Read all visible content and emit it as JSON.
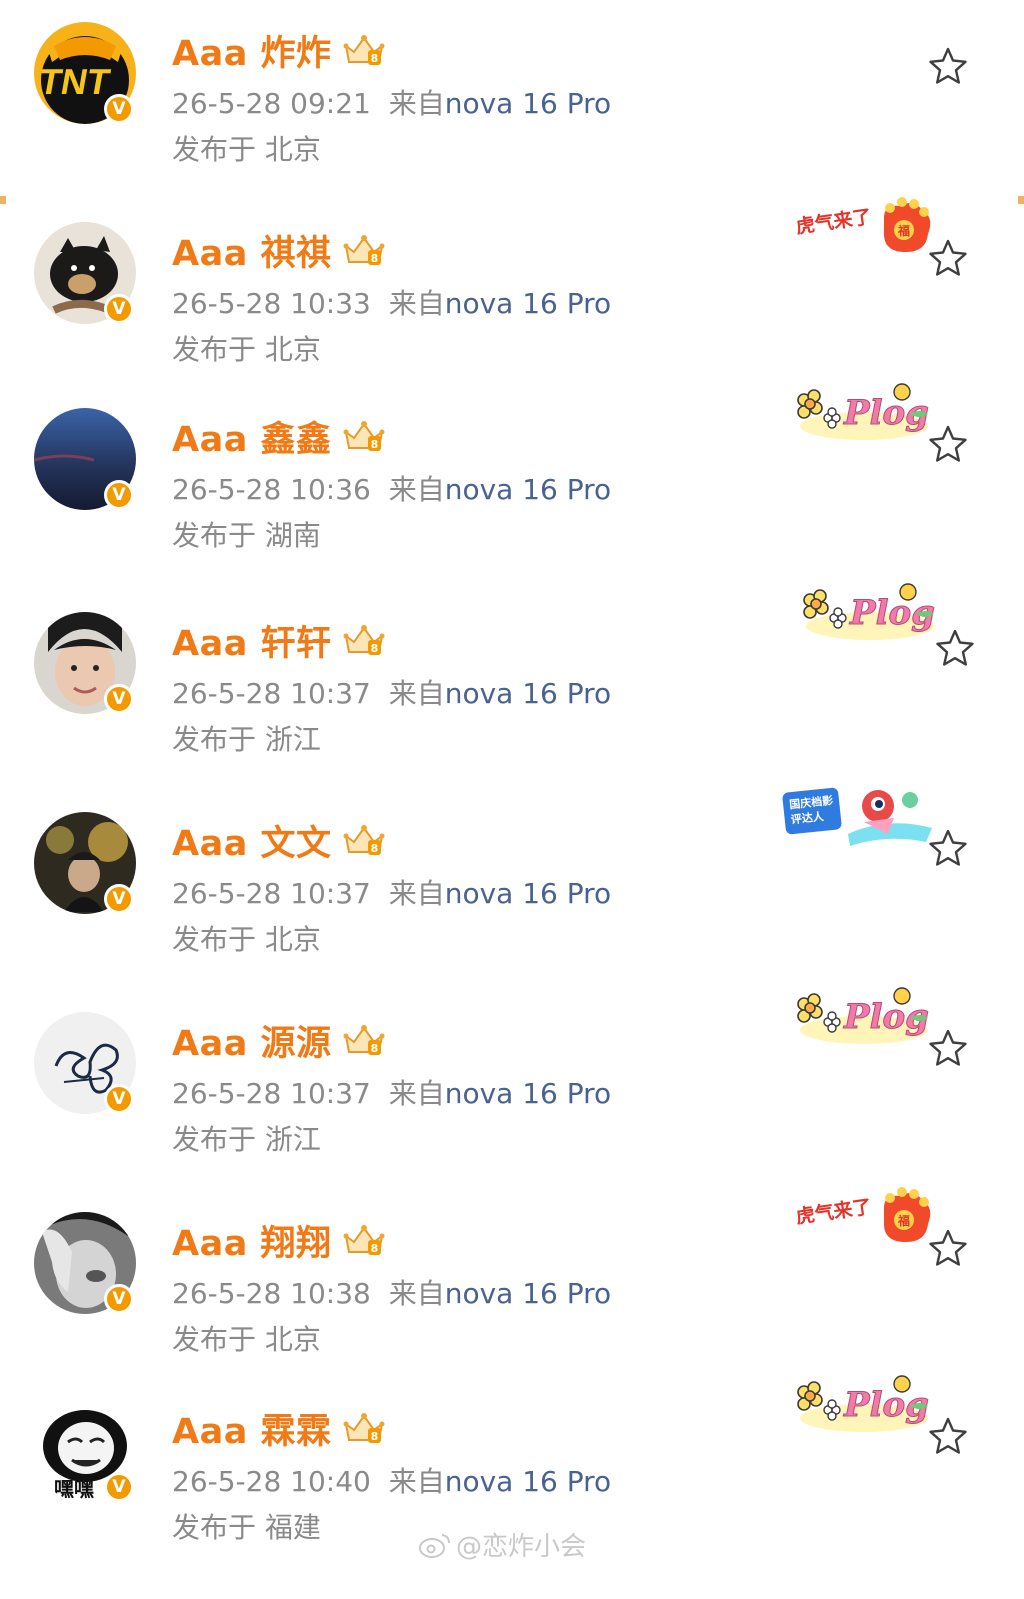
{
  "posts": [
    {
      "name": "Aaa 炸炸",
      "time": "26-5-28 09:21",
      "from": "来自",
      "device": "nova 16 Pro",
      "location": "发布于 北京",
      "avatar_icon": "tnt-tiger-avatar-icon",
      "sticker": "none"
    },
    {
      "name": "Aaa 祺祺",
      "time": "26-5-28 10:33",
      "from": "来自",
      "device": "nova 16 Pro",
      "location": "发布于 北京",
      "avatar_icon": "shiba-dog-avatar-icon",
      "sticker": "tiger-paw",
      "sticker_text": "虎气来了"
    },
    {
      "name": "Aaa 鑫鑫",
      "time": "26-5-28 10:36",
      "from": "来自",
      "device": "nova 16 Pro",
      "location": "发布于 湖南",
      "avatar_icon": "night-sky-avatar-icon",
      "sticker": "plog",
      "sticker_text": "Plog"
    },
    {
      "name": "Aaa 轩轩",
      "time": "26-5-28 10:37",
      "from": "来自",
      "device": "nova 16 Pro",
      "location": "发布于 浙江",
      "avatar_icon": "face-photo-avatar-icon",
      "sticker": "plog",
      "sticker_text": "Plog"
    },
    {
      "name": "Aaa 文文",
      "time": "26-5-28 10:37",
      "from": "来自",
      "device": "nova 16 Pro",
      "location": "发布于 北京",
      "avatar_icon": "stage-photo-avatar-icon",
      "sticker": "critic",
      "sticker_text": "国庆档影评达人"
    },
    {
      "name": "Aaa 源源",
      "time": "26-5-28 10:37",
      "from": "来自",
      "device": "nova 16 Pro",
      "location": "发布于 浙江",
      "avatar_icon": "butterfly-signature-avatar-icon",
      "sticker": "plog",
      "sticker_text": "Plog"
    },
    {
      "name": "Aaa 翔翔",
      "time": "26-5-28 10:38",
      "from": "来自",
      "device": "nova 16 Pro",
      "location": "发布于 北京",
      "avatar_icon": "bw-hand-photo-avatar-icon",
      "sticker": "tiger-paw",
      "sticker_text": "虎气来了"
    },
    {
      "name": "Aaa 霖霖",
      "time": "26-5-28 10:40",
      "from": "来自",
      "device": "nova 16 Pro",
      "location": "发布于 福建",
      "avatar_icon": "panda-meme-avatar-icon",
      "avatar_text": "嘿嘿",
      "sticker": "plog",
      "sticker_text": "Plog"
    }
  ],
  "verified_badge": "V",
  "watermark": "@恋炸小会",
  "colors": {
    "name": "#f07b16",
    "meta": "#8a8a8a",
    "device": "#4a6290",
    "badge": "#f39a00"
  }
}
